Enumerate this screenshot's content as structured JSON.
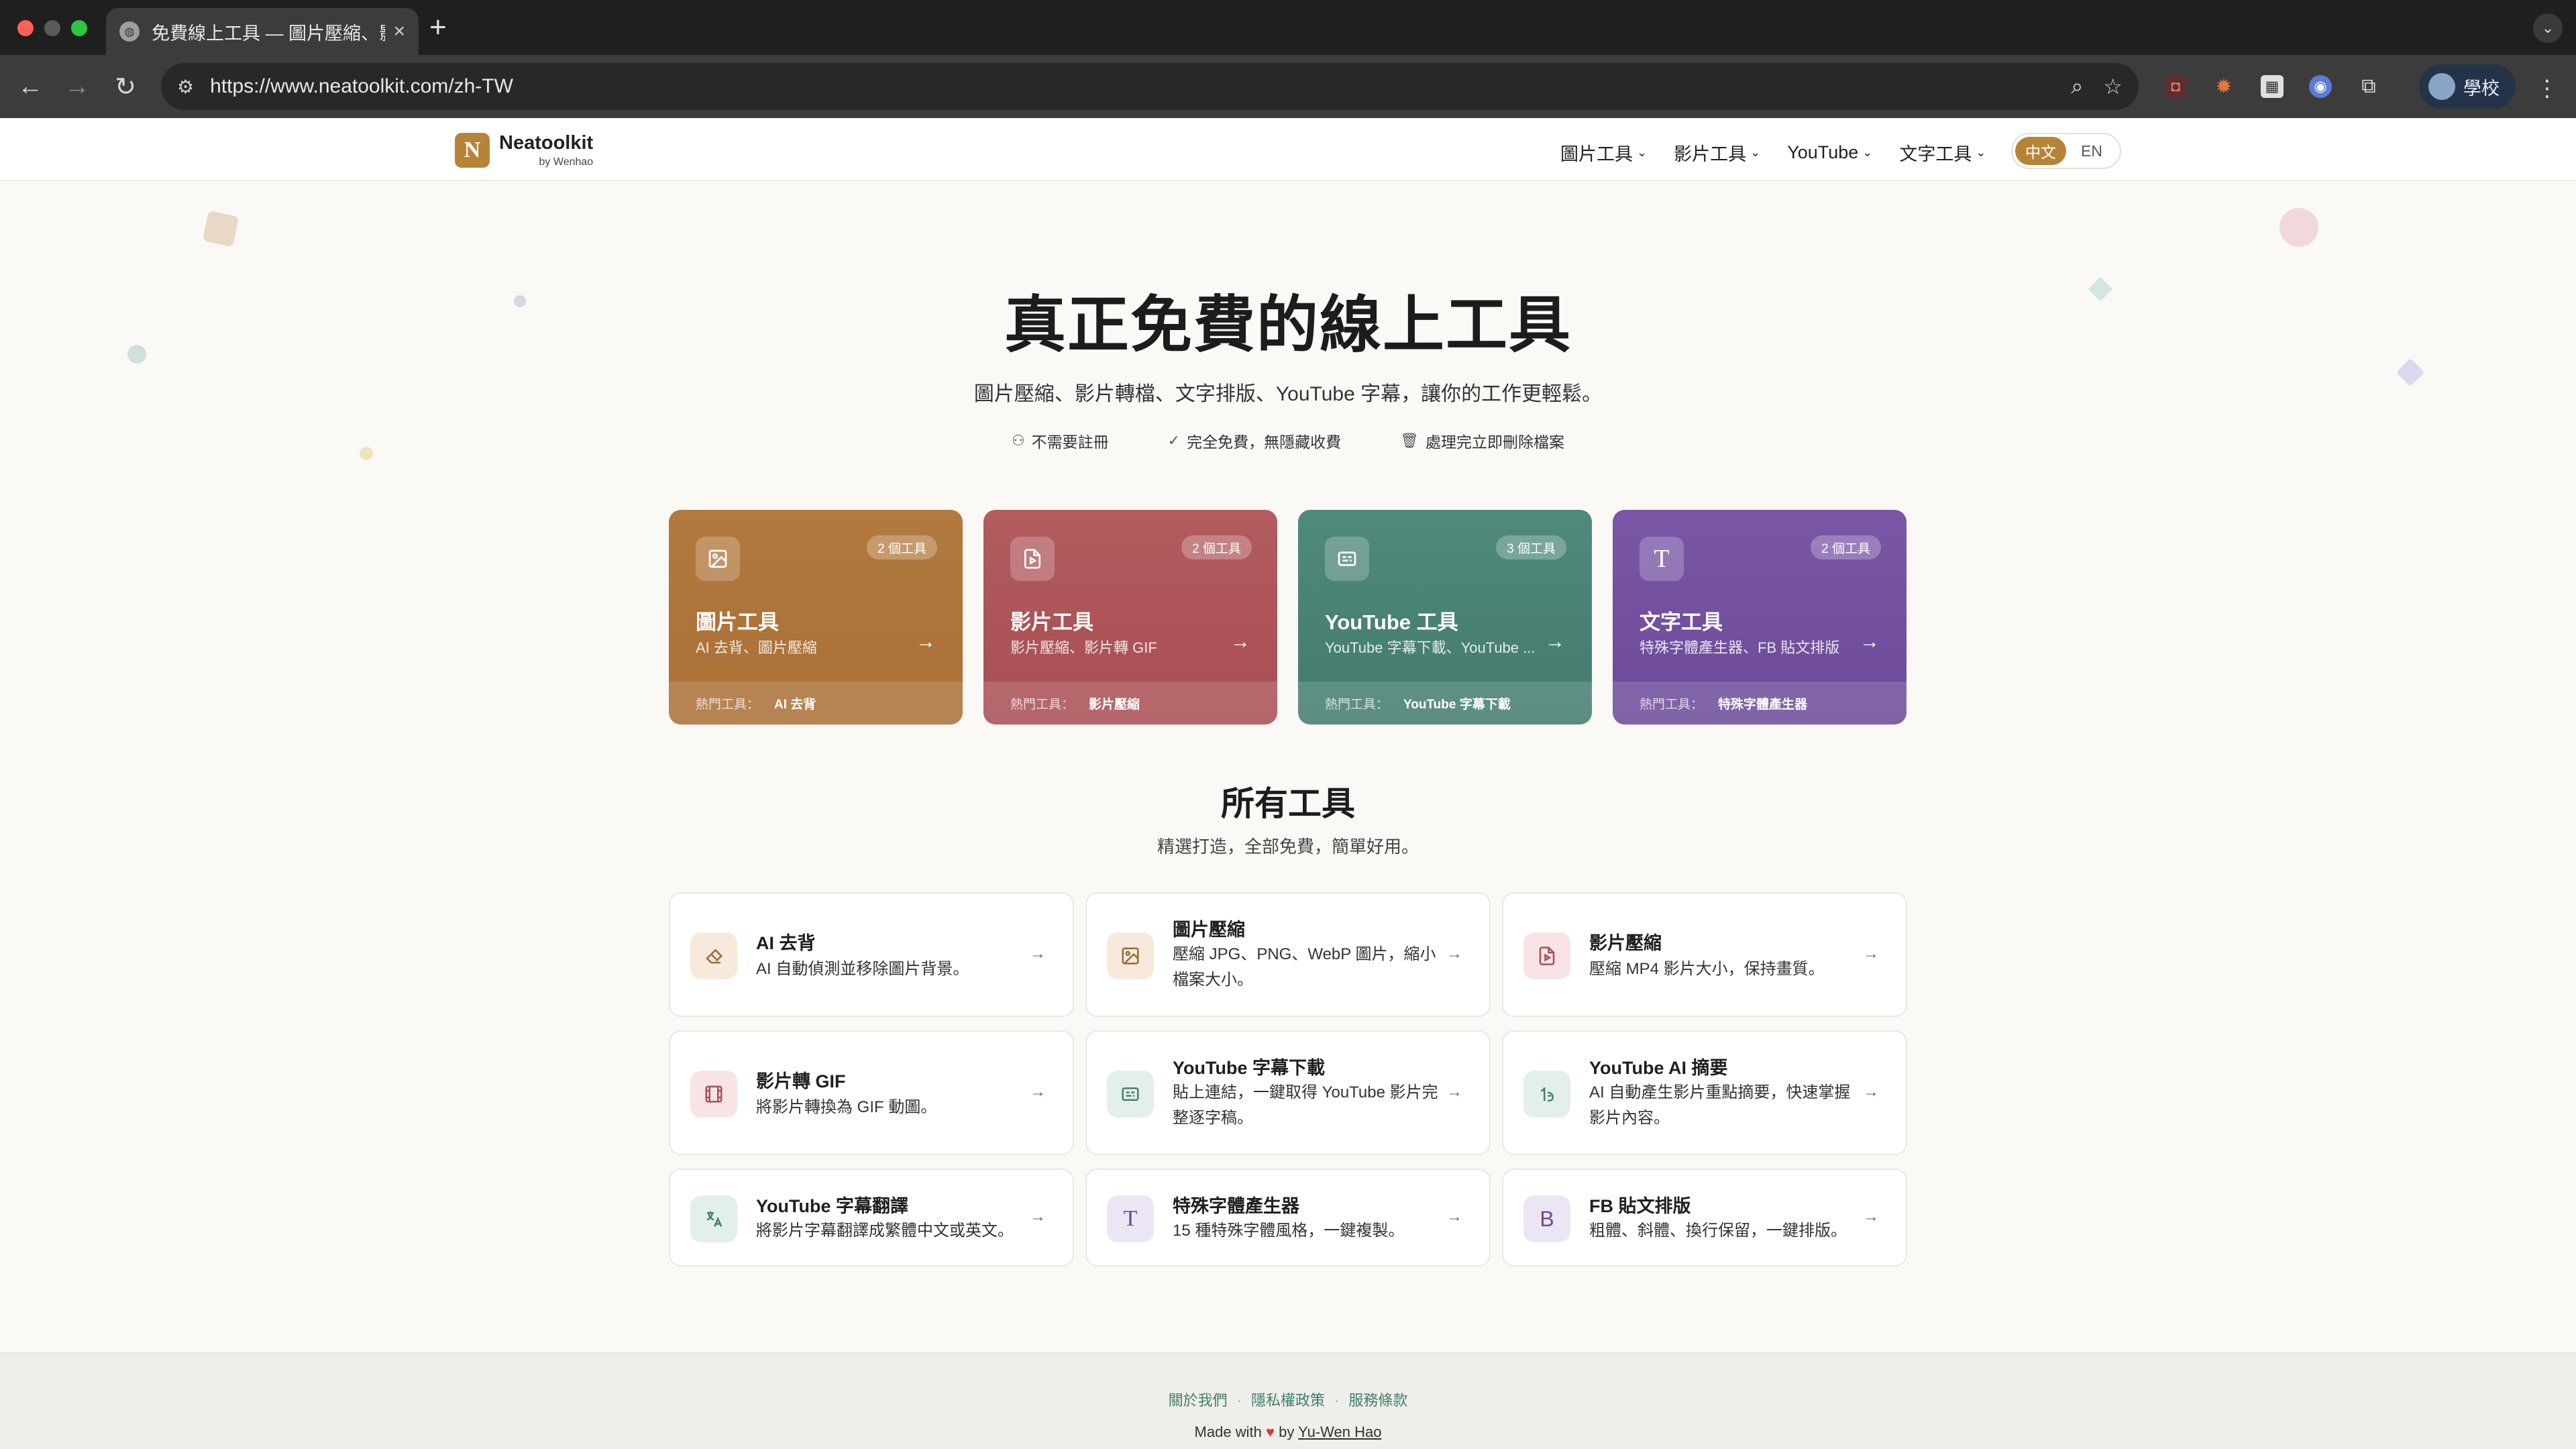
{
  "browser": {
    "tab_title": "免費線上工具 — 圖片壓縮、影片",
    "url": "https://www.neatoolkit.com/zh-TW",
    "profile_label": "學校"
  },
  "header": {
    "logo_mark": "N",
    "logo_name": "Neatoolkit",
    "logo_by": "by Wenhao",
    "nav": [
      "圖片工具",
      "影片工具",
      "YouTube",
      "文字工具"
    ],
    "lang_active": "中文",
    "lang_other": "EN"
  },
  "hero": {
    "title_before": "真正",
    "title_highlight": "免費",
    "title_after": "的線上工具",
    "subtitle": "圖片壓縮、影片轉檔、文字排版、YouTube 字幕，讓你的工作更輕鬆。",
    "features": [
      "不需要註冊",
      "完全免費，無隱藏收費",
      "處理完立即刪除檔案"
    ]
  },
  "categories": [
    {
      "title": "圖片工具",
      "desc": "AI 去背、圖片壓縮",
      "badge": "2 個工具",
      "popular_label": "熱門工具：",
      "popular": "AI 去背",
      "icon": "image-icon",
      "color": "#b27a3f"
    },
    {
      "title": "影片工具",
      "desc": "影片壓縮、影片轉 GIF",
      "badge": "2 個工具",
      "popular_label": "熱門工具：",
      "popular": "影片壓縮",
      "icon": "video-file-icon",
      "color": "#b25c5e"
    },
    {
      "title": "YouTube 工具",
      "desc": "YouTube 字幕下載、YouTube ...",
      "badge": "3 個工具",
      "popular_label": "熱門工具：",
      "popular": "YouTube 字幕下載",
      "icon": "subtitles-icon",
      "color": "#4f8a7c"
    },
    {
      "title": "文字工具",
      "desc": "特殊字體產生器、FB 貼文排版",
      "badge": "2 個工具",
      "popular_label": "熱門工具：",
      "popular": "特殊字體產生器",
      "icon": "text-icon",
      "color": "#7a57a6"
    }
  ],
  "tools_section": {
    "title": "所有工具",
    "subtitle": "精選打造，全部免費，簡單好用。"
  },
  "tools": [
    {
      "name": "AI 去背",
      "desc": "AI 自動偵測並移除圖片背景。",
      "icon": "eraser-icon"
    },
    {
      "name": "圖片壓縮",
      "desc": "壓縮 JPG、PNG、WebP 圖片，縮小檔案大小。",
      "icon": "image-icon"
    },
    {
      "name": "影片壓縮",
      "desc": "壓縮 MP4 影片大小，保持畫質。",
      "icon": "video-file-icon"
    },
    {
      "name": "影片轉 GIF",
      "desc": "將影片轉換為 GIF 動圖。",
      "icon": "film-icon"
    },
    {
      "name": "YouTube 字幕下載",
      "desc": "貼上連結，一鍵取得 YouTube 影片完整逐字稿。",
      "icon": "subtitles-icon"
    },
    {
      "name": "YouTube AI 摘要",
      "desc": "AI 自動產生影片重點摘要，快速掌握影片內容。",
      "icon": "ai-summary-icon"
    },
    {
      "name": "YouTube 字幕翻譯",
      "desc": "將影片字幕翻譯成繁體中文或英文。",
      "icon": "translate-icon"
    },
    {
      "name": "特殊字體產生器",
      "desc": "15 種特殊字體風格，一鍵複製。",
      "icon": "text-icon"
    },
    {
      "name": "FB 貼文排版",
      "desc": "粗體、斜體、換行保留，一鍵排版。",
      "icon": "bold-icon"
    }
  ],
  "footer": {
    "links": [
      "關於我們",
      "隱私權政策",
      "服務條款"
    ],
    "made_prefix": "Made with",
    "made_by": "by",
    "author": "Yu-Wen Hao"
  }
}
